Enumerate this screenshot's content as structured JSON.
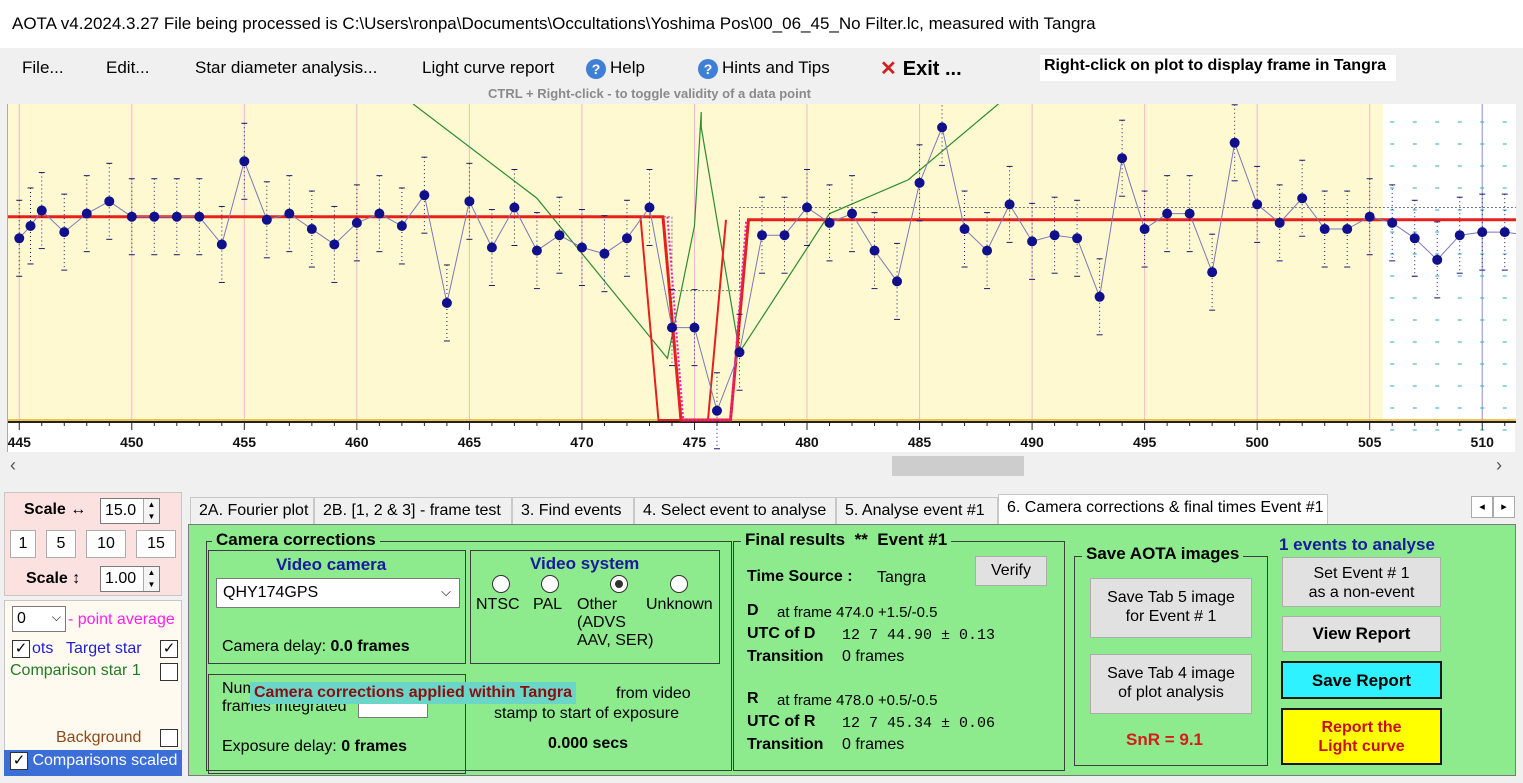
{
  "title": "AOTA v4.2024.3.27     File being processed is C:\\Users\\ronpa\\Documents\\Occultations\\Yoshima Pos\\00_06_45_No Filter.lc, measured with Tangra",
  "menu": {
    "file": "File...",
    "edit": "Edit...",
    "star_diameter": "Star diameter analysis...",
    "light_curve_report": "Light curve report",
    "help": "Help",
    "hints": "Hints and Tips",
    "exit": "Exit ...",
    "help_icon": "help-icon"
  },
  "hint_right_click": "Right-click on plot to display frame in Tangra",
  "hint_ctrl": "CTRL + Right-click  -  to toggle validity of a data point",
  "chart_data": {
    "type": "line",
    "x_ticks": [
      "445",
      "450",
      "455",
      "460",
      "465",
      "470",
      "475",
      "480",
      "485",
      "490",
      "495",
      "500",
      "505",
      "510"
    ],
    "xlim": [
      444.5,
      511.5
    ],
    "ylim": [
      0,
      100
    ],
    "series": [
      {
        "x": [
          445,
          445.5,
          446,
          447,
          448,
          449,
          450,
          451,
          452,
          453,
          454,
          455,
          456,
          457,
          458,
          459,
          460,
          461,
          462,
          463,
          464,
          465,
          466,
          467,
          468,
          469,
          470,
          471,
          472,
          473,
          474,
          475,
          476,
          477,
          478,
          479,
          480,
          481,
          482,
          483,
          484,
          485,
          486,
          487,
          488,
          489,
          490,
          491,
          492,
          493,
          494,
          495,
          496,
          497,
          498,
          499,
          500,
          501,
          502,
          503,
          504,
          505,
          506,
          507,
          508,
          509,
          510,
          511,
          512
        ],
        "y": [
          59,
          63,
          68,
          61,
          67,
          71,
          66,
          66,
          66,
          66,
          57,
          84,
          65,
          67,
          62,
          57,
          64,
          67,
          63,
          73,
          38,
          71,
          56,
          69,
          55,
          60,
          56,
          54,
          59,
          69,
          30,
          30,
          3,
          22,
          60,
          60,
          69,
          64,
          67,
          55,
          45,
          77,
          95,
          62,
          55,
          70,
          58,
          60,
          59,
          40,
          85,
          62,
          67,
          67,
          48,
          90,
          70,
          64,
          72,
          62,
          62,
          66,
          64,
          59,
          52,
          60,
          61,
          61,
          60
        ]
      }
    ]
  },
  "scale": {
    "h_label": "Scale ↔",
    "h_value": "15.0",
    "btn1": "1",
    "btn5": "5",
    "btn10": "10",
    "btn15": "15",
    "v_label": "Scale ↕",
    "v_value": "1.00"
  },
  "options": {
    "point_avg_value": "0",
    "point_avg_label": "- point average",
    "dots_label": "ots",
    "target_star": "Target star",
    "comparison_star": "Comparison star 1",
    "background": "Background",
    "comparisons_scaled": "Comparisons scaled"
  },
  "tabs": [
    "2A. Fourier plot",
    "2B. [1, 2 & 3] - frame test",
    "3. Find events",
    "4. Select event to analyse",
    "5. Analyse event #1",
    "6. Camera corrections & final times Event #1"
  ],
  "camera": {
    "group_title": "Camera corrections",
    "video_camera_label": "Video camera",
    "camera_value": "QHY174GPS",
    "camera_delay_label": "Camera delay:",
    "camera_delay_value": "0.0 frames",
    "video_system_label": "Video system",
    "radio_ntsc": "NTSC",
    "radio_pal": "PAL",
    "radio_other": "Other",
    "radio_other_sub": "(ADVS",
    "radio_other_sub2": "AAV, SER)",
    "radio_unknown": "Unknown",
    "num_frames_label": "Num",
    "frames_integrated_label": "frames integrated",
    "applied_banner": "Camera corrections applied within Tangra",
    "from_video_label": "from video",
    "stamp_label": "stamp to start of exposure",
    "exposure_delay_label": "Exposure delay:",
    "exposure_delay_value": "0 frames",
    "secs_value": "0.000 secs"
  },
  "final": {
    "title": "Final results",
    "stars": "**",
    "event": "Event #1",
    "verify": "Verify",
    "time_source_label": "Time Source :",
    "time_source_value": "Tangra",
    "d_label": "D",
    "d_frame": "at frame 474.0  +1.5/-0.5",
    "utc_d_label": "UTC of D",
    "utc_d_value": "12  7 44.90  ± 0.13",
    "transition_label": "Transition",
    "transition_d": "0 frames",
    "r_label": "R",
    "r_frame": "at frame 478.0  +0.5/-0.5",
    "utc_r_label": "UTC of R",
    "utc_r_value": "12  7 45.34  ± 0.06",
    "transition_r": "0 frames"
  },
  "save_images": {
    "title": "Save AOTA images",
    "tab5_line1": "Save Tab 5 image",
    "tab5_line2": "for Event # 1",
    "tab4_line1": "Save Tab 4 image",
    "tab4_line2": "of plot analysis",
    "snr": "SnR = 9.1"
  },
  "report": {
    "events_count": "1  events to analyse",
    "set_nonevent_line1": "Set Event # 1",
    "set_nonevent_line2": "as a non-event",
    "view_report": "View Report",
    "save_report": "Save Report",
    "report_line1": "Report the",
    "report_line2": "Light curve"
  },
  "colors": {
    "plot_bg": "#fff9d2",
    "model_line": "#e8201c",
    "data_points": "#10108c",
    "green_line": "#2e8b2e",
    "panel_green": "#8dea8d",
    "save_report_bg": "#2ef2ff",
    "report_curve_bg": "#ffff00"
  }
}
